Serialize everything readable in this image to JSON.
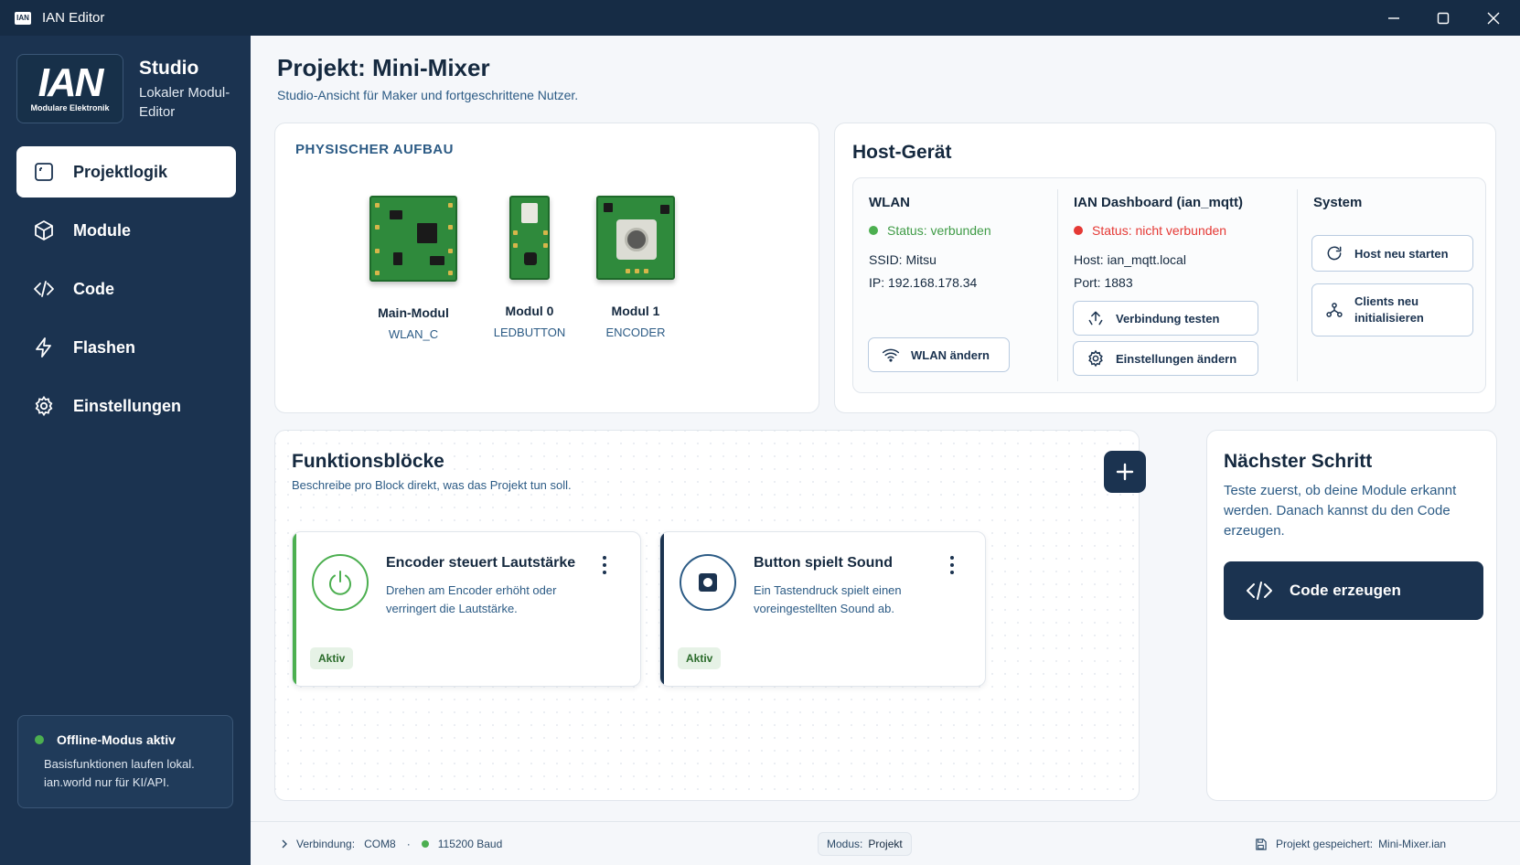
{
  "window": {
    "app_icon_text": "IAN",
    "title": "IAN Editor"
  },
  "sidebar": {
    "logo_big": "IAN",
    "logo_small": "Modulare Elektronik",
    "brand_title": "Studio",
    "brand_subtitle": "Lokaler Modul-Editor",
    "items": [
      {
        "label": "Projektlogik",
        "icon": "project-logic-icon",
        "active": true
      },
      {
        "label": "Module",
        "icon": "cube-icon"
      },
      {
        "label": "Code",
        "icon": "code-icon"
      },
      {
        "label": "Flashen",
        "icon": "lightning-icon"
      },
      {
        "label": "Einstellungen",
        "icon": "gear-icon"
      }
    ],
    "offline": {
      "title": "Offline-Modus aktiv",
      "line1": "Basisfunktionen laufen lokal.",
      "line2": "ian.world nur für KI/API."
    }
  },
  "page": {
    "title": "Projekt: Mini-Mixer",
    "subtitle": "Studio-Ansicht für Maker und fortgeschrittene Nutzer."
  },
  "physical": {
    "label": "PHYSISCHER AUFBAU",
    "modules": [
      {
        "name": "Main-Modul",
        "type": "WLAN_C"
      },
      {
        "name": "Modul 0",
        "type": "LEDBUTTON"
      },
      {
        "name": "Modul 1",
        "type": "ENCODER"
      }
    ]
  },
  "host": {
    "title": "Host-Gerät",
    "wlan": {
      "heading": "WLAN",
      "status": "Status: verbunden",
      "ssid": "SSID: Mitsu",
      "ip": "IP: 192.168.178.34",
      "change_button": "WLAN ändern"
    },
    "dashboard": {
      "heading": "IAN Dashboard (ian_mqtt)",
      "status": "Status: nicht verbunden",
      "host": "Host: ian_mqtt.local",
      "port": "Port: 1883",
      "test_button": "Verbindung testen",
      "settings_button": "Einstellungen ändern"
    },
    "system": {
      "heading": "System",
      "restart_button": "Host neu starten",
      "reinit_line1": "Clients neu",
      "reinit_line2": "initialisieren"
    }
  },
  "functions": {
    "title": "Funktionsblöcke",
    "subtitle": "Beschreibe pro Block direkt, was das Projekt tun soll.",
    "blocks": [
      {
        "title": "Encoder steuert Lautstärke",
        "desc": "Drehen am Encoder erhöht oder verringert die Lautstärke.",
        "badge": "Aktiv",
        "accent": "#4caf50"
      },
      {
        "title": "Button spielt Sound",
        "desc": "Ein Tastendruck spielt einen voreingestellten Sound ab.",
        "badge": "Aktiv",
        "accent": "#1b3350"
      }
    ]
  },
  "next": {
    "title": "Nächster Schritt",
    "text": "Teste zuerst, ob deine Module erkannt werden. Danach kannst du den Code erzeugen.",
    "button": "Code erzeugen"
  },
  "statusbar": {
    "connection_label": "Verbindung:",
    "connection_value": "COM8",
    "separator": "·",
    "baud": "115200 Baud",
    "mode_label": "Modus:",
    "mode_value": "Projekt",
    "saved_label": "Projekt gespeichert:",
    "saved_value": "Mini-Mixer.ian"
  },
  "colors": {
    "sidebar_bg": "#1b3350",
    "titlebar_bg": "#162c45",
    "status_ok": "#4caf50",
    "status_error": "#e53935",
    "accent_blue": "#2c5b85"
  }
}
